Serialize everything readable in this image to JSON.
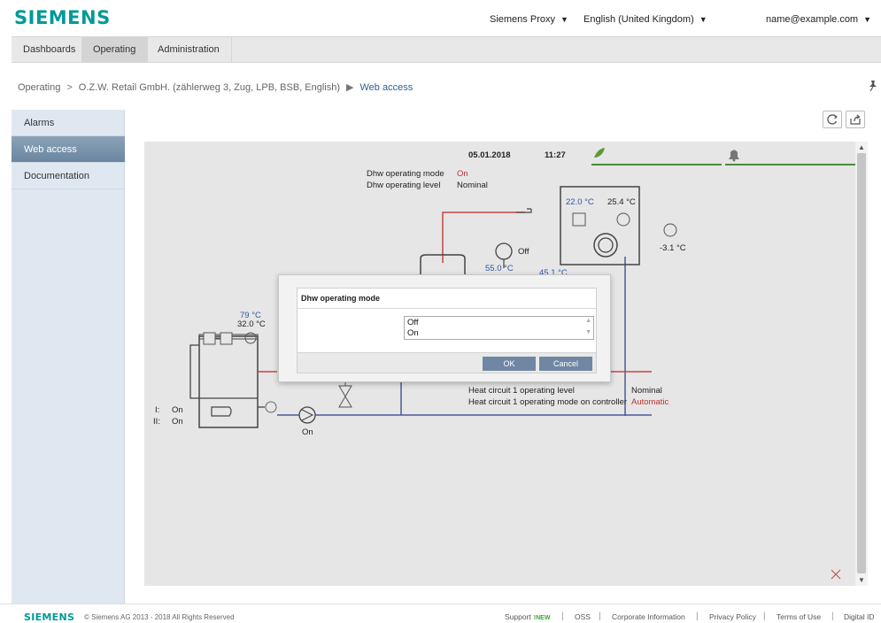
{
  "header": {
    "logo": "SIEMENS",
    "proxy": "Siemens Proxy",
    "language": "English (United Kingdom)",
    "user": "name@example.com"
  },
  "nav": {
    "tabs": [
      {
        "label": "Dashboards"
      },
      {
        "label": "Operating",
        "active": true
      },
      {
        "label": "Administration"
      }
    ]
  },
  "breadcrumb": {
    "root": "Operating",
    "site": "O.Z.W. Retail GmbH. (zählerweg 3, Zug, LPB, BSB, English)",
    "current": "Web access"
  },
  "sidebar": {
    "items": [
      {
        "label": "Alarms"
      },
      {
        "label": "Web access",
        "active": true
      },
      {
        "label": "Documentation"
      }
    ]
  },
  "plant": {
    "date": "05.01.2018",
    "time": "11:27",
    "dhw_mode_label": "Dhw operating mode",
    "dhw_mode_value": "On",
    "dhw_level_label": "Dhw operating level",
    "dhw_level_value": "Nominal",
    "room_temp_setpoint": "22.0 °C",
    "room_temp_actual": "25.4 °C",
    "outside_temp": "-3.1 °C",
    "pump_off": "Off",
    "storage_temp_setpoint": "55.0 °C",
    "flow_temp": "45.1 °C",
    "boiler_temp_setpoint": "79 °C",
    "boiler_temp_actual": "32.0 °C",
    "burner_stage1_label": "I:",
    "burner_stage1_value": "On",
    "burner_stage2_label": "II:",
    "burner_stage2_value": "On",
    "pump_on": "On",
    "hc1_level_label": "Heat circuit 1 operating level",
    "hc1_level_value": "Nominal",
    "hc1_mode_label": "Heat circuit 1 operating mode on controller",
    "hc1_mode_value": "Automatic"
  },
  "modal": {
    "title": "Dhw operating mode",
    "options": [
      "Off",
      "On"
    ],
    "ok_label": "OK",
    "cancel_label": "Cancel"
  },
  "footer": {
    "logo": "SIEMENS",
    "copyright": "© Siemens AG 2013 - 2018 All Rights Reserved",
    "links": {
      "support": "Support",
      "new_badge": "!NEW",
      "oss": "OSS",
      "corporate": "Corporate Information",
      "privacy": "Privacy Policy",
      "terms": "Terms of Use",
      "digital_id": "Digital ID"
    }
  },
  "colors": {
    "brand": "#009999",
    "accent_blue": "#2e56a6",
    "alert_red": "#c03030",
    "status_green": "#3a8a2a"
  }
}
